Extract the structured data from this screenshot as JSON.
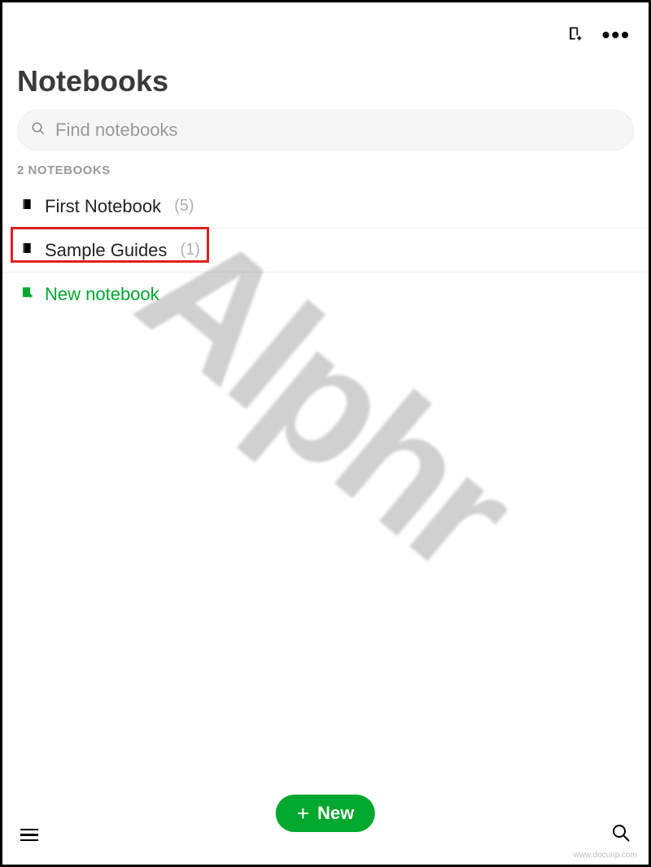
{
  "header": {
    "title": "Notebooks"
  },
  "search": {
    "placeholder": "Find notebooks"
  },
  "section": {
    "label": "2 NOTEBOOKS"
  },
  "notebooks": [
    {
      "name": "First Notebook",
      "count": "(5)"
    },
    {
      "name": "Sample Guides",
      "count": "(1)"
    }
  ],
  "new_notebook_label": "New notebook",
  "fab": {
    "label": "New"
  },
  "watermark": {
    "text": "Alphr",
    "source": "www.docurip.com"
  }
}
